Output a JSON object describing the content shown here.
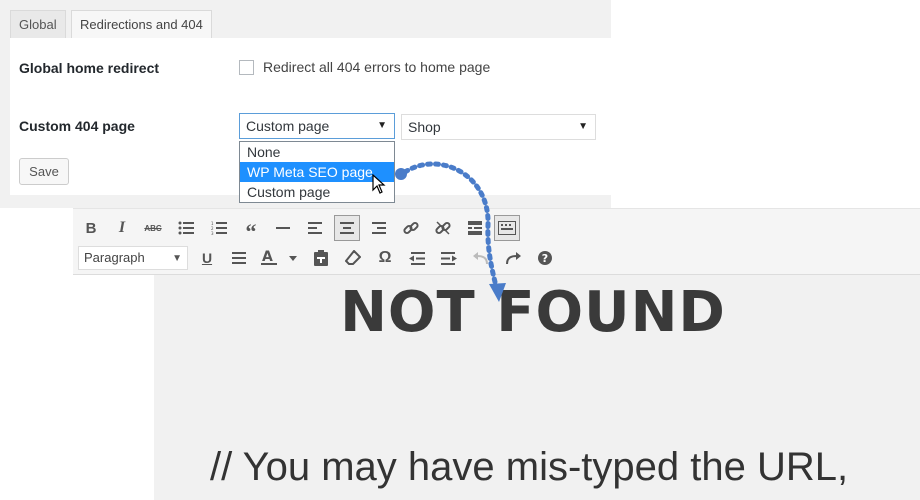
{
  "tabs": [
    {
      "label": "Global",
      "active": false
    },
    {
      "label": "Redirections and 404",
      "active": true
    }
  ],
  "settings": {
    "global_home_redirect": {
      "label": "Global home redirect",
      "checkbox_text": "Redirect all 404 errors to home page",
      "checked": false
    },
    "custom_404": {
      "label": "Custom 404 page",
      "selected": "Custom page",
      "options": [
        "None",
        "WP Meta SEO page",
        "Custom page"
      ],
      "highlighted_option": "WP Meta SEO page",
      "page_select": "Shop"
    },
    "save_label": "Save"
  },
  "editor": {
    "format_select": "Paragraph",
    "toolbar_row1": [
      "bold-icon",
      "italic-icon",
      "strikethrough-icon",
      "bullet-list-icon",
      "numbered-list-icon",
      "blockquote-icon",
      "horizontal-line-icon",
      "align-left-icon",
      "align-center-icon",
      "align-right-icon",
      "link-icon",
      "unlink-icon",
      "read-more-icon",
      "toolbar-toggle-icon"
    ],
    "toolbar_row2": [
      "underline-icon",
      "justify-icon",
      "text-color-icon",
      "paste-text-icon",
      "clear-formatting-icon",
      "special-character-icon",
      "outdent-icon",
      "indent-icon",
      "undo-icon",
      "redo-icon",
      "help-icon"
    ],
    "headline": "NOT FOUND",
    "body_line": "// You may have mis-typed the URL,"
  },
  "colors": {
    "accent": "#1e90ff",
    "arrow": "#4a7cc9"
  }
}
